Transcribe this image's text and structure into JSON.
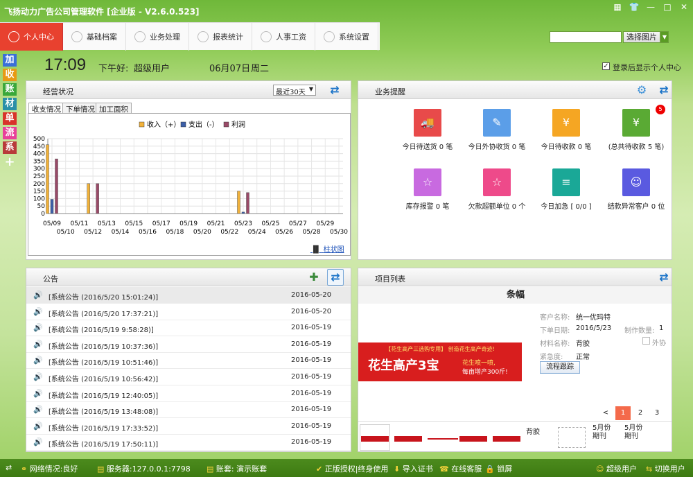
{
  "title": "飞扬动力广告公司管理软件 [企业版 - V2.6.0.523]",
  "tabs": [
    {
      "label": "个人中心",
      "active": true
    },
    {
      "label": "基础档案"
    },
    {
      "label": "业务处理"
    },
    {
      "label": "报表统计"
    },
    {
      "label": "人事工资"
    },
    {
      "label": "系统设置"
    }
  ],
  "search": {
    "value": "",
    "button": "选择图片"
  },
  "quick": [
    "加",
    "收",
    "账",
    "材",
    "单",
    "流",
    "系",
    "+"
  ],
  "quick_colors": [
    "#3a6fd8",
    "#e89a14",
    "#3aa83a",
    "#2a8fa8",
    "#d8342a",
    "#e8409a",
    "#b83a3a",
    "#5a9c24"
  ],
  "header": {
    "time": "17:09",
    "greeting": "下午好:",
    "user": "超级用户",
    "date": "06月07日",
    "weekday": "周二",
    "show_label": "登录后显示个人中心",
    "show_checked": true
  },
  "ops": {
    "title": "经营状况",
    "range": "最近30天",
    "tabs": [
      "收支情况",
      "下单情况",
      "加工面积"
    ],
    "chart_link": "柱状图"
  },
  "chart_data": {
    "type": "bar",
    "categories": [
      "05/09",
      "05/10",
      "05/11",
      "05/12",
      "05/13",
      "05/14",
      "05/15",
      "05/16",
      "05/17",
      "05/18",
      "05/19",
      "05/20",
      "05/21",
      "05/22",
      "05/23",
      "05/24",
      "05/25",
      "05/26",
      "05/27",
      "05/28",
      "05/29",
      "05/30"
    ],
    "series": [
      {
        "name": "收入（+）",
        "color": "#f2b23a",
        "values": [
          460,
          0,
          0,
          200,
          0,
          0,
          0,
          0,
          0,
          0,
          0,
          0,
          0,
          0,
          150,
          0,
          0,
          0,
          0,
          0,
          0,
          0
        ]
      },
      {
        "name": "支出（-）",
        "color": "#3c5fa8",
        "values": [
          95,
          0,
          0,
          0,
          0,
          0,
          0,
          0,
          0,
          0,
          0,
          0,
          0,
          0,
          10,
          0,
          0,
          0,
          0,
          0,
          0,
          0
        ]
      },
      {
        "name": "利润",
        "color": "#9a4a68",
        "values": [
          365,
          0,
          0,
          200,
          0,
          0,
          0,
          0,
          0,
          0,
          0,
          0,
          0,
          0,
          140,
          0,
          0,
          0,
          0,
          0,
          0,
          0
        ]
      }
    ],
    "yticks": [
      0,
      50,
      100,
      150,
      200,
      250,
      300,
      350,
      400,
      450,
      500
    ],
    "ylim": [
      0,
      500
    ],
    "grid": true,
    "legend": "top-center"
  },
  "biz": {
    "title": "业务提醒",
    "items": [
      {
        "label": "今日待送货 0 笔",
        "color": "#e84a4a",
        "icon": "truck-icon",
        "glyph": "🚚"
      },
      {
        "label": "今日外协收货 0 笔",
        "color": "#5b9ee8",
        "icon": "edit-icon",
        "glyph": "✎"
      },
      {
        "label": "今日待收款 0 笔",
        "color": "#f5a623",
        "icon": "yen-shield-icon",
        "glyph": "¥"
      },
      {
        "label": "(总共待收款 5 笔)",
        "color": "#5aaa34",
        "icon": "yen-icon",
        "glyph": "¥",
        "badge": "5"
      },
      {
        "label": "库存报警 0 笔",
        "color": "#c86ae0",
        "icon": "star-icon",
        "glyph": "☆"
      },
      {
        "label": "欠款超额单位 0 个",
        "color": "#ee4a8a",
        "icon": "star-icon",
        "glyph": "☆"
      },
      {
        "label": "今日加急 [ 0/0 ]",
        "color": "#1aa897",
        "icon": "list-icon",
        "glyph": "≡"
      },
      {
        "label": "结款异常客户 0 位",
        "color": "#5a5ae0",
        "icon": "calendar-icon",
        "glyph": "☺"
      }
    ]
  },
  "notice": {
    "title": "公告",
    "rows": [
      {
        "text": "[系统公告 (2016/5/20 15:01:24)]",
        "date": "2016-05-20"
      },
      {
        "text": "[系统公告 (2016/5/20 17:37:21)]",
        "date": "2016-05-20"
      },
      {
        "text": "[系统公告 (2016/5/19 9:58:28)]",
        "date": "2016-05-19"
      },
      {
        "text": "[系统公告 (2016/5/19 10:37:36)]",
        "date": "2016-05-19"
      },
      {
        "text": "[系统公告 (2016/5/19 10:51:46)]",
        "date": "2016-05-19"
      },
      {
        "text": "[系统公告 (2016/5/19 10:56:42)]",
        "date": "2016-05-19"
      },
      {
        "text": "[系统公告 (2016/5/19 12:40:05)]",
        "date": "2016-05-19"
      },
      {
        "text": "[系统公告 (2016/5/19 13:48:08)]",
        "date": "2016-05-19"
      },
      {
        "text": "[系统公告 (2016/5/19 17:33:52)]",
        "date": "2016-05-19"
      },
      {
        "text": "[系统公告 (2016/5/19 17:50:11)]",
        "date": "2016-05-19"
      }
    ]
  },
  "project": {
    "title": "项目列表",
    "name": "条幅",
    "banner_top": "【花生高产三选购专用】 创造花生高产奇迹!",
    "banner_big": "花生高产3宝",
    "banner_side1": "花生喷一喷,",
    "banner_side2": "每亩增产300斤!",
    "fields": [
      {
        "label": "客户名称:",
        "value": "统一优玛特"
      },
      {
        "label": "下单日期:",
        "value": "2016/5/23"
      },
      {
        "label": "材料名称:",
        "value": "背胶"
      },
      {
        "label": "紧急度:",
        "value": "正常"
      }
    ],
    "qty_label": "制作数量:",
    "qty": "1",
    "outsource": "外协",
    "trace_btn": "流程跟踪",
    "pages": [
      "<",
      "1",
      "2",
      "3",
      ">"
    ],
    "thumb_labels": [
      "背胶",
      "5月份期刊",
      "5月份期刊"
    ]
  },
  "status": {
    "net": "网络情况:良好",
    "server": "服务器:127.0.0.1:7798",
    "account": "账套: 演示账套",
    "license": "正版授权|终身使用",
    "import": "导入证书",
    "online": "在线客服",
    "lock": "锁屏",
    "user": "超级用户",
    "switch": "切换用户"
  }
}
